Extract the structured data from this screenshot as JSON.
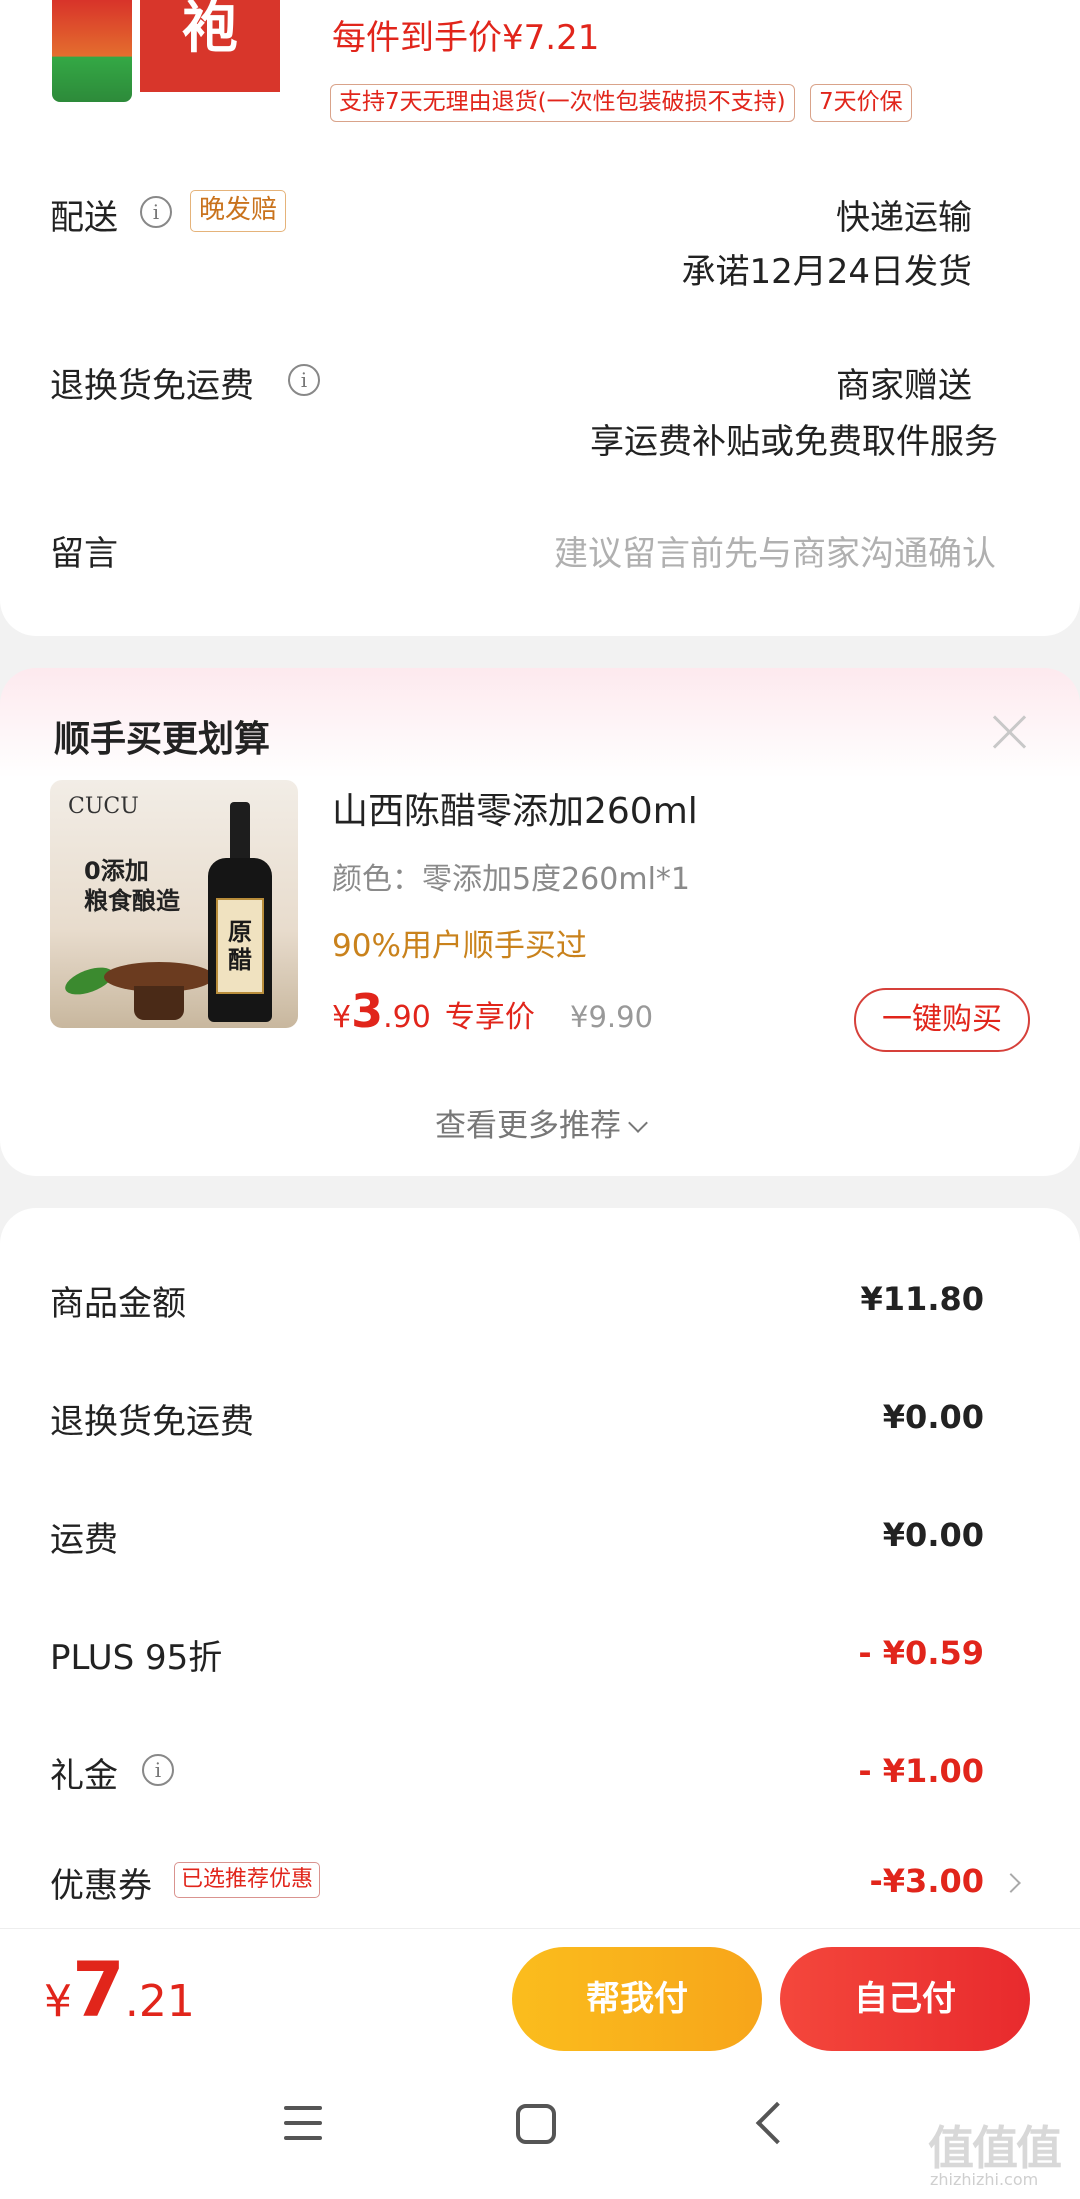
{
  "top_product": {
    "thumb_text": "袍",
    "price_note": "每件到手价¥7.21",
    "return_tag": "支持7天无理由退货(一次性包装破损不支持)",
    "price_protect_tag": "7天价保"
  },
  "delivery": {
    "label": "配送",
    "late_tag": "晚发赔",
    "method": "快递运输",
    "promise": "承诺12月24日发货"
  },
  "return_shipping": {
    "label": "退换货免运费",
    "value_line1": "商家赠送",
    "value_line2": "享运费补贴或免费取件服务"
  },
  "message": {
    "label": "留言",
    "placeholder": "建议留言前先与商家沟通确认"
  },
  "upsell": {
    "title": "顺手买更划算",
    "brand": "CUCU",
    "image_copy_line1": "0添加",
    "image_copy_line2": "粮食酿造",
    "bottle_label_1": "原",
    "bottle_label_2": "醋",
    "product_name": "山西陈醋零添加260ml",
    "spec": "颜色：零添加5度260ml*1",
    "social_proof": "90%用户顺手买过",
    "price_currency": "¥",
    "price_int": "3",
    "price_dec": ".90",
    "price_label": "专享价",
    "original_price": "¥9.90",
    "buy_label": "一键购买",
    "more_label": "查看更多推荐"
  },
  "summary": {
    "rows": [
      {
        "label": "商品金额",
        "value": "¥11.80"
      },
      {
        "label": "退换货免运费",
        "value": "¥0.00"
      },
      {
        "label": "运费",
        "value": "¥0.00"
      },
      {
        "label": "PLUS 95折",
        "value": "- ¥0.59"
      },
      {
        "label": "礼金",
        "value": "- ¥1.00"
      },
      {
        "label": "优惠券",
        "value": "-¥3.00",
        "tag": "已选推荐优惠"
      }
    ]
  },
  "bottom_bar": {
    "currency": "¥",
    "total_int": "7",
    "total_dec": ".21",
    "friend_pay": "帮我付",
    "self_pay": "自己付"
  },
  "watermark": {
    "text": "值值值",
    "url": "zhizhizhi.com"
  },
  "colors": {
    "accent_red": "#e1251b",
    "pay_yellow": "#fbbd1d",
    "tag_orange": "#c9731d"
  }
}
